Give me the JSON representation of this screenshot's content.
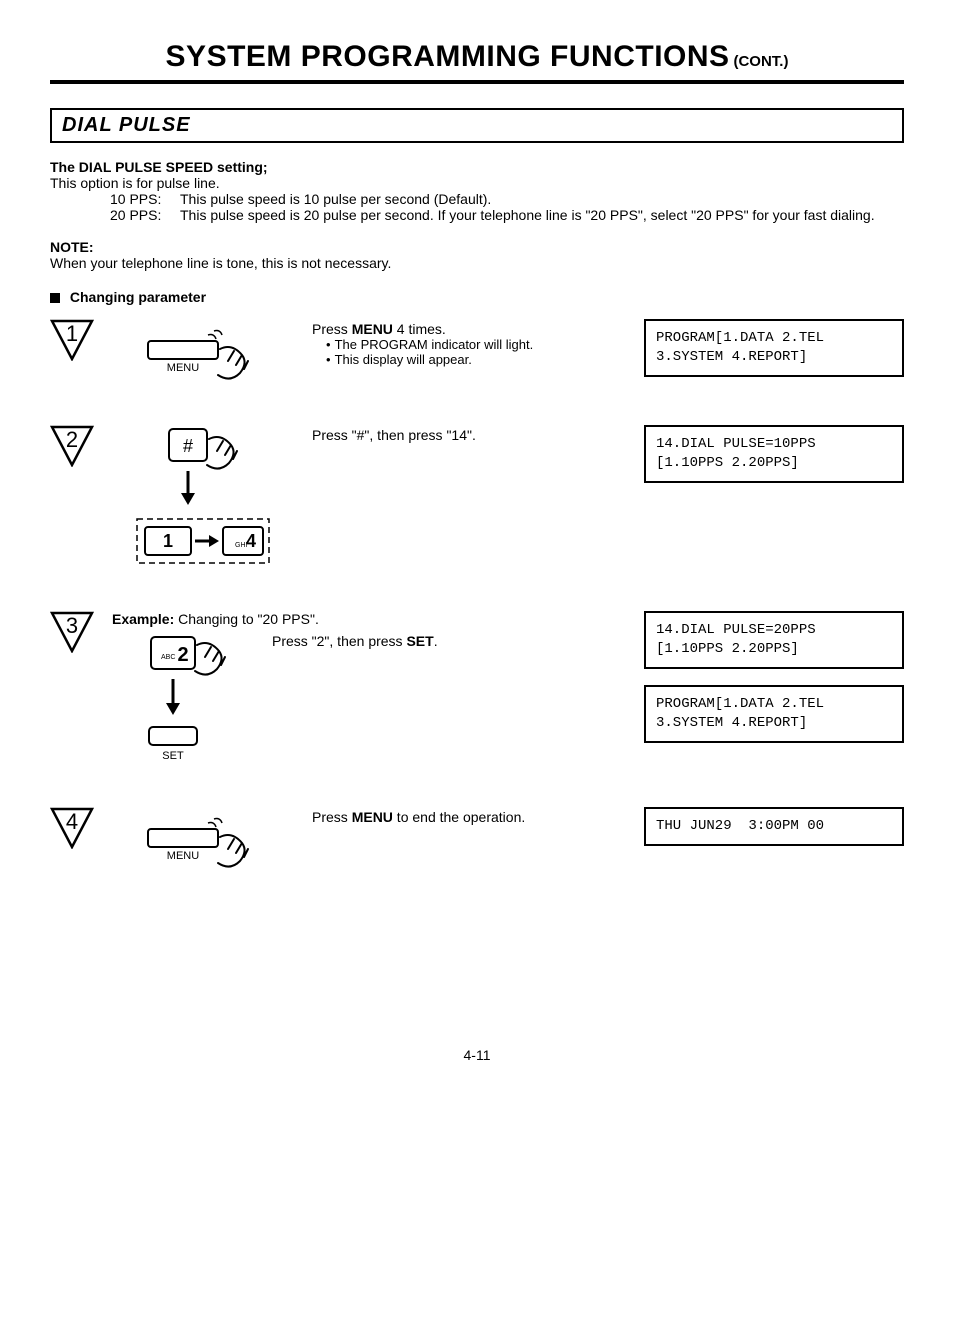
{
  "header": {
    "title_main": "SYSTEM PROGRAMMING FUNCTIONS",
    "title_cont": "(CONT.)"
  },
  "section": {
    "title": "DIAL PULSE"
  },
  "setting": {
    "heading": "The DIAL PULSE SPEED setting;",
    "intro": "This option is for pulse line.",
    "pps10_label": "10 PPS:",
    "pps10_text": "This pulse speed is 10 pulse per second (Default).",
    "pps20_label": "20 PPS:",
    "pps20_text": "This pulse speed is 20 pulse per second. If your telephone line is \"20 PPS\", select \"20 PPS\" for your fast dialing."
  },
  "note": {
    "heading": "NOTE:",
    "text": "When your telephone line is tone, this is not necessary."
  },
  "changing": {
    "heading": "Changing parameter"
  },
  "steps": {
    "s1": {
      "num": "1",
      "key_label": "MENU",
      "instr_prefix": "Press ",
      "instr_bold": "MENU",
      "instr_suffix": " 4 times.",
      "bullet1": "The PROGRAM indicator will light.",
      "bullet2": "This display will appear.",
      "display": "PROGRAM[1.DATA 2.TEL\n3.SYSTEM 4.REPORT]"
    },
    "s2": {
      "num": "2",
      "hash_label": "#",
      "key1_label": "1",
      "key4_small": "GHI",
      "key4_label": "4",
      "instr": "Press \"#\", then press \"14\".",
      "display": "14.DIAL PULSE=10PPS\n[1.10PPS 2.20PPS]"
    },
    "s3": {
      "num": "3",
      "example_bold": "Example:",
      "example_text": "Changing to \"20 PPS\".",
      "key2_small": "ABC",
      "key2_label": "2",
      "set_label": "SET",
      "instr_prefix": "Press \"2\", then press ",
      "instr_bold": "SET",
      "instr_suffix": ".",
      "display1": "14.DIAL PULSE=20PPS\n[1.10PPS 2.20PPS]",
      "display2": "PROGRAM[1.DATA 2.TEL\n3.SYSTEM 4.REPORT]"
    },
    "s4": {
      "num": "4",
      "key_label": "MENU",
      "instr_prefix": "Press ",
      "instr_bold": "MENU",
      "instr_suffix": " to end the operation.",
      "display": "THU JUN29  3:00PM 00"
    }
  },
  "footer": {
    "page": "4-11"
  }
}
